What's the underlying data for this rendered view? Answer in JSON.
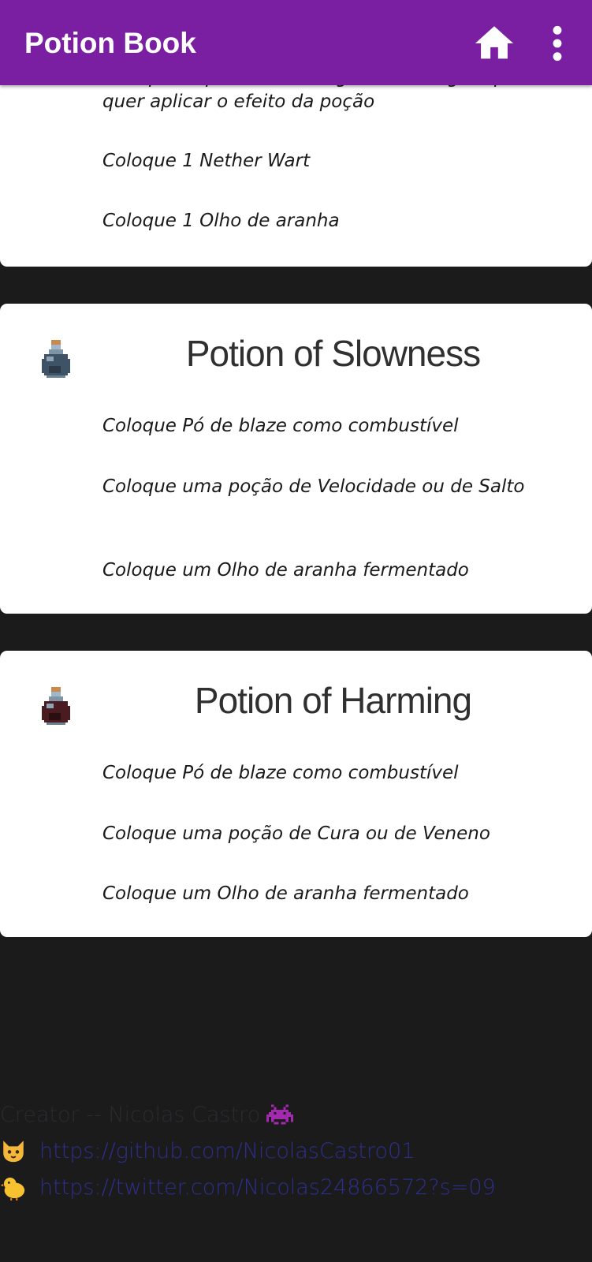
{
  "app_bar": {
    "title": "Potion Book",
    "home_icon": "home-icon",
    "menu_icon": "more-vert-icon",
    "background_color": "#7b1fa2"
  },
  "cards": [
    {
      "partial": true,
      "steps": [
        "Coloque a quantidade de garrafa de água que quer aplicar o efeito da poção",
        "Coloque 1 Nether Wart",
        "Coloque 1 Olho de aranha"
      ]
    },
    {
      "title": "Potion of Slowness",
      "icon": "slowness-potion-icon",
      "steps": [
        "Coloque Pó de blaze como combustível",
        "Coloque uma poção de Velocidade ou de Salto",
        "Coloque um Olho de aranha fermentado"
      ]
    },
    {
      "title": "Potion of Harming",
      "icon": "harming-potion-icon",
      "steps": [
        "Coloque Pó de blaze como combustível",
        "Coloque uma poção de Cura ou de Veneno",
        "Coloque um Olho de aranha fermentado"
      ]
    }
  ],
  "footer": {
    "credit": "Creator -- Nicolas Castro",
    "credit_icon": "space-invader-icon",
    "github_icon": "cat-icon",
    "github_url": "https://github.com/NicolasCastro01",
    "twitter_icon": "chick-icon",
    "twitter_url": "https://twitter.com/Nicolas24866572?s=09"
  }
}
